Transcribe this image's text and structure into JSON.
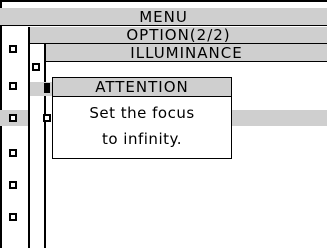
{
  "menu": {
    "title": "MENU"
  },
  "option": {
    "title": "OPTION(2/2)"
  },
  "illuminance": {
    "title": "ILLUMINANCE"
  },
  "dialog": {
    "title": "ATTENTION",
    "message_line1": "Set the focus",
    "message_line2": "to infinity."
  },
  "colors": {
    "highlight": "#cfcfcf",
    "background": "#ffffff",
    "foreground": "#000000"
  }
}
